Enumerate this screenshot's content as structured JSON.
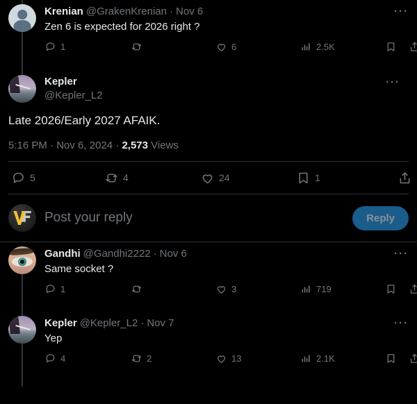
{
  "theme": {
    "background": "#000000",
    "text_primary": "#e7e9ea",
    "text_secondary": "#71767b",
    "separator": "#2f3336",
    "thread_line": "#333639",
    "reply_button_bg": "#1a5c8a",
    "reply_button_text": "#8a9299"
  },
  "posts": [
    {
      "id": "krenian-post",
      "display_name": "Krenian",
      "handle": "@GrakenKrenian",
      "separator": "·",
      "date": "Nov 6",
      "text": "Zen 6 is expected for 2026 right ?",
      "avatar": "default-avatar",
      "more_label": "···",
      "actions": {
        "reply_count": "1",
        "retweet_count": "",
        "like_count": "6",
        "views_count": "2.5K",
        "bookmark_count": "",
        "share_count": ""
      }
    },
    {
      "id": "gandhi-post",
      "display_name": "Gandhi",
      "handle": "@Gandhi2222",
      "separator": "·",
      "date": "Nov 6",
      "text": "Same socket ?",
      "avatar": "eye-avatar",
      "more_label": "···",
      "actions": {
        "reply_count": "1",
        "retweet_count": "",
        "like_count": "3",
        "views_count": "719",
        "bookmark_count": "",
        "share_count": ""
      }
    },
    {
      "id": "kepler-reply-post",
      "display_name": "Kepler",
      "handle": "@Kepler_L2",
      "separator": "·",
      "date": "Nov 7",
      "text": "Yep",
      "avatar": "kepler-avatar",
      "more_label": "···",
      "actions": {
        "reply_count": "4",
        "retweet_count": "2",
        "like_count": "13",
        "views_count": "2.1K",
        "bookmark_count": "",
        "share_count": ""
      }
    }
  ],
  "focused_post": {
    "id": "kepler-main-post",
    "display_name": "Kepler",
    "handle": "@Kepler_L2",
    "avatar": "kepler-avatar",
    "text": "Late 2026/Early 2027 AFAIK.",
    "more_label": "···",
    "meta": {
      "time": "5:16 PM",
      "dot1": "·",
      "date": "Nov 6, 2024",
      "dot2": "·",
      "views_value": "2,573",
      "views_label": "Views"
    },
    "actions": {
      "reply_count": "5",
      "retweet_count": "4",
      "like_count": "24",
      "bookmark_count": "1",
      "share_count": ""
    }
  },
  "composer": {
    "placeholder": "Post your reply",
    "value": "",
    "avatar": "v-logo-avatar",
    "reply_button_label": "Reply"
  }
}
